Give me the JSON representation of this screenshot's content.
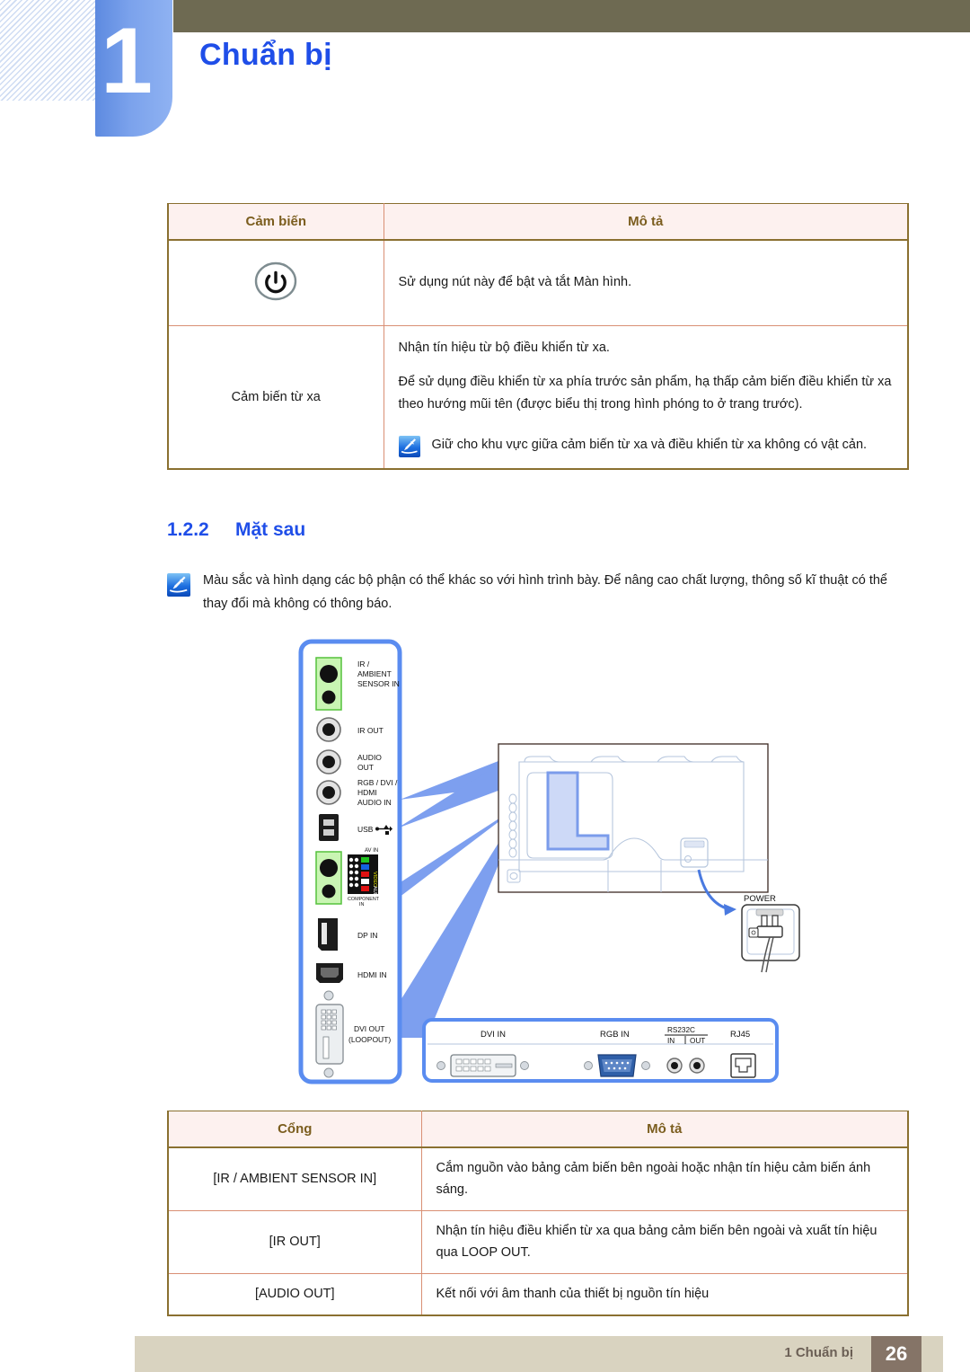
{
  "header": {
    "chapter_number": "1",
    "chapter_title": "Chuẩn bị"
  },
  "sensor_table": {
    "headers": [
      "Cảm biến",
      "Mô tả"
    ],
    "rows": [
      {
        "sensor_icon": "power-button-icon",
        "sensor_label": "",
        "description": "Sử dụng nút này để bật và tắt Màn hình."
      },
      {
        "sensor_icon": "",
        "sensor_label": "Cảm biến từ xa",
        "para1": "Nhận tín hiệu từ bộ điều khiển từ xa.",
        "para2": "Để sử dụng điều khiển từ xa phía trước sản phẩm, hạ thấp cảm biến điều khiển từ xa theo hướng mũi tên (được biểu thị trong hình phóng to ở trang trước).",
        "note": "Giữ cho khu vực giữa cảm biến từ xa và điều khiển từ xa không có vật cản."
      }
    ]
  },
  "section": {
    "number": "1.2.2",
    "title": "Mặt sau"
  },
  "note": {
    "text": "Màu sắc và hình dạng các bộ phận có thể khác so với hình trình bày. Để nâng cao chất lượng, thông số kĩ thuật có thể thay đổi mà không có thông báo."
  },
  "diagram": {
    "side_panel_ports": [
      "IR /\nAMBIENT\nSENSOR IN",
      "IR OUT",
      "AUDIO\nOUT",
      "RGB / DVI /\nHDMI\nAUDIO IN",
      "USB",
      "AV IN",
      "DP IN",
      "HDMI IN",
      "DVI OUT\n(LOOPOUT)"
    ],
    "av_in_label": "AV IN",
    "component_in_label": "COMPONENT\nIN",
    "av_side_labels": [
      "VIDEO",
      "AUDIO"
    ],
    "bottom_panel_labels": [
      "DVI IN",
      "RGB IN",
      "RS232C",
      "IN",
      "OUT",
      "RJ45"
    ],
    "power_label": "POWER",
    "usb_label": "USB",
    "dp_label": "DP IN",
    "hdmi_label": "HDMI IN",
    "dvi_out_label_1": "DVI OUT",
    "dvi_out_label_2": "(LOOPOUT)",
    "ir_ambient_1": "IR /",
    "ir_ambient_2": "AMBIENT",
    "ir_ambient_3": "SENSOR IN",
    "ir_out_label": "IR OUT",
    "audio_out_1": "AUDIO",
    "audio_out_2": "OUT",
    "rgb_dvi_1": "RGB / DVI /",
    "rgb_dvi_2": "HDMI",
    "rgb_dvi_3": "AUDIO IN",
    "colors": {
      "panel_blue": "#5a8cf0",
      "connector_green": "#b6f2a0",
      "callout_blue": "#7d9fef",
      "vga_blue": "#2f5fa8"
    }
  },
  "port_table": {
    "headers": [
      "Cổng",
      "Mô tả"
    ],
    "rows": [
      {
        "port": "[IR / AMBIENT SENSOR IN]",
        "description": "Cắm nguồn vào bảng cảm biến bên ngoài hoặc nhận tín hiệu cảm biến ánh sáng."
      },
      {
        "port": "[IR OUT]",
        "description": "Nhận tín hiệu điều khiển từ xa qua bảng cảm biến bên ngoài và xuất tín hiệu qua LOOP OUT."
      },
      {
        "port": "[AUDIO OUT]",
        "description": "Kết nối với âm thanh của thiết bị nguồn tín hiệu"
      }
    ]
  },
  "footer": {
    "label": "1 Chuẩn bị",
    "page": "26"
  }
}
